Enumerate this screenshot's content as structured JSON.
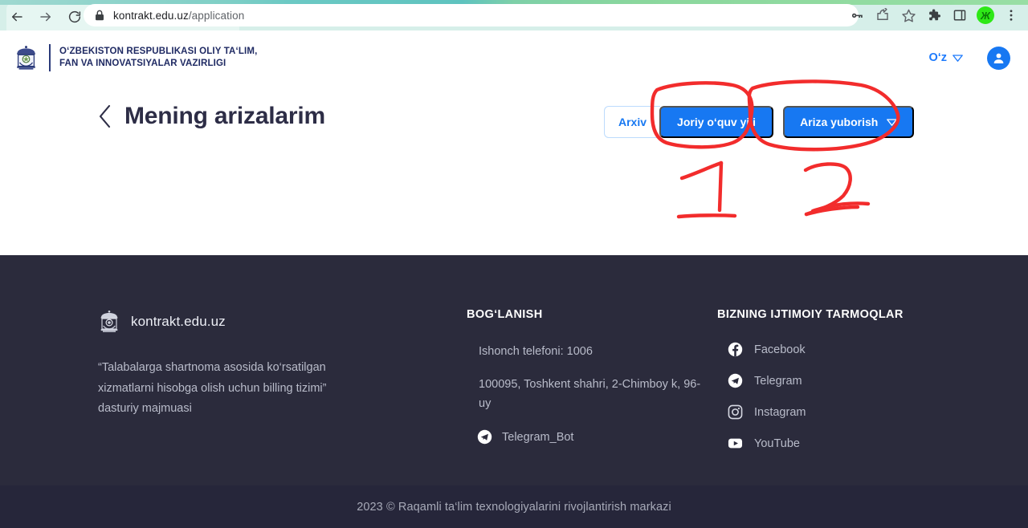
{
  "browser": {
    "back_label": "Back",
    "forward_label": "Forward",
    "reload_label": "Reload",
    "lock_icon": "lock-icon",
    "url_host": "kontrakt.edu.uz",
    "url_path": "/application",
    "toolbar_icons": [
      "password-key-icon",
      "share-icon",
      "bookmark-star-icon",
      "extensions-puzzle-icon",
      "side-panel-icon",
      "profile-avatar-icon",
      "three-dot-menu-icon"
    ],
    "profile_initial": "Ж"
  },
  "header": {
    "emblem_icon": "ministry-emblem-icon",
    "ministry_line1": "O‘ZBEKISTON RESPUBLIKASI OLIY TA‘LIM,",
    "ministry_line2": "FAN VA INNOVATSIYALAR VAZIRLIGI",
    "language": "O‘z",
    "language_chevron": "chevron-down-icon",
    "avatar_icon": "user-avatar-icon"
  },
  "page": {
    "back_icon": "chevron-left-icon",
    "title": "Mening arizalarim",
    "buttons": {
      "archive": "Arxiv",
      "current_year": "Joriy o‘quv yili",
      "submit_application": "Ariza yuborish",
      "submit_chevron": "chevron-down-icon"
    }
  },
  "annotations": {
    "marker_color": "#f22c2c",
    "labels": [
      "1",
      "2"
    ],
    "shapes": [
      "hand-drawn-circle-around-current-year-button",
      "hand-drawn-circle-around-submit-button"
    ]
  },
  "footer": {
    "brand": {
      "emblem_icon": "footer-emblem-icon",
      "name": "kontrakt.edu.uz",
      "slogan": "“Talabalarga shartnoma asosida ko‘rsatilgan xizmatlarni hisobga olish uchun billing tizimi” dasturiy majmuasi"
    },
    "contact": {
      "heading": "BOG‘LANISH",
      "lines": [
        "Ishonch telefoni: 1006",
        "100095, Toshkent shahri, 2-Chimboy k, 96-uy"
      ],
      "telegram_bot": {
        "icon": "telegram-icon",
        "label": "Telegram_Bot"
      }
    },
    "social": {
      "heading": "BIZNING IJTIMOIY TARMOQLAR",
      "items": [
        {
          "icon": "facebook-icon",
          "label": "Facebook"
        },
        {
          "icon": "telegram-icon",
          "label": "Telegram"
        },
        {
          "icon": "instagram-icon",
          "label": "Instagram"
        },
        {
          "icon": "youtube-icon",
          "label": "YouTube"
        }
      ]
    },
    "copyright": "2023 © Raqamli ta‘lim texnologiyalarini rivojlantirish markazi"
  },
  "colors": {
    "accent_blue": "#1778f2",
    "footer_bg": "#2b2b3c",
    "copyright_bg": "#26263a",
    "title_color": "#2d2d46"
  }
}
